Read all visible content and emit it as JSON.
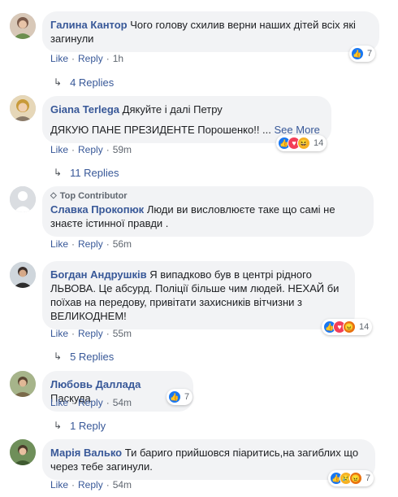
{
  "comments": [
    {
      "author": "Галина Кантор",
      "text": "Чого голову схилив верни наших дітей всіх які загинули",
      "actions": {
        "like": "Like",
        "reply": "Reply",
        "time": "1h"
      },
      "reactions": {
        "types": [
          "like"
        ],
        "count": "7"
      },
      "replies": "4 Replies"
    },
    {
      "author": "Giana Terlega",
      "text": "Дякуйте і далі Петру",
      "text2": "ДЯКУЮ ПАНЕ ПРЕЗИДЕНТЕ Порошенко!! ...",
      "see_more": "See More",
      "actions": {
        "like": "Like",
        "reply": "Reply",
        "time": "59m"
      },
      "reactions": {
        "types": [
          "like",
          "love",
          "haha"
        ],
        "count": "14"
      },
      "replies": "11 Replies"
    },
    {
      "badge": "Top Contributor",
      "author": "Славка Прокопюк",
      "text": "Люди ви висловлюєте таке що самі не знаєте істинної правди .",
      "actions": {
        "like": "Like",
        "reply": "Reply",
        "time": "56m"
      }
    },
    {
      "author": "Богдан Андрушків",
      "text": "Я випадково був в центрі рідного ЛЬВОВА. Це абсурд. Поліції більше чим людей. НЕХАЙ би поїхав на передову, привітати захисників вітчизни з ВЕЛИКОДНЕМ!",
      "actions": {
        "like": "Like",
        "reply": "Reply",
        "time": "55m"
      },
      "reactions": {
        "types": [
          "like",
          "love",
          "angry"
        ],
        "count": "14"
      },
      "replies": "5 Replies"
    },
    {
      "author": "Любовь Даллада",
      "text": "Паскуда",
      "actions": {
        "like": "Like",
        "reply": "Reply",
        "time": "54m"
      },
      "reactions": {
        "types": [
          "like"
        ],
        "count": "7"
      },
      "replies": "1 Reply"
    },
    {
      "author": "Марія Валько",
      "text": "Ти бариго прийшовся піаритись,на загиблих що через тебе загинули.",
      "actions": {
        "like": "Like",
        "reply": "Reply",
        "time": "54m"
      },
      "reactions": {
        "types": [
          "like",
          "sad",
          "angry"
        ],
        "count": "7"
      }
    }
  ],
  "colors": {
    "author": "#385898",
    "bubble": "#f2f3f5",
    "meta": "#606770",
    "like": "#1877f2",
    "love": "#f33e58",
    "haha": "#f7b125",
    "angry": "#e9710f"
  },
  "icons": {
    "like": "thumbs-up-icon",
    "love": "heart-icon",
    "haha": "laughing-face-icon",
    "sad": "sad-face-icon",
    "angry": "angry-face-icon",
    "reply_arrow": "reply-arrow-icon",
    "badge": "diamond-icon"
  }
}
